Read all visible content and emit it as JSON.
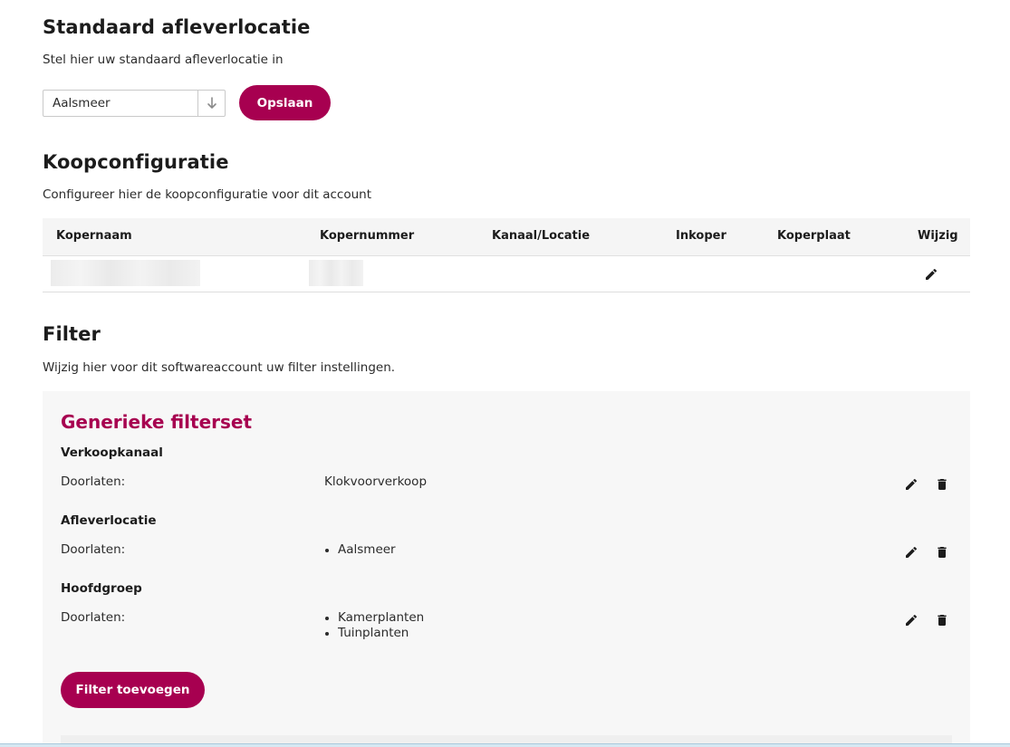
{
  "delivery": {
    "title": "Standaard afleverlocatie",
    "subtitle": "Stel hier uw standaard afleverlocatie in",
    "selected_location": "Aalsmeer",
    "save_label": "Opslaan"
  },
  "buy_config": {
    "title": "Koopconfiguratie",
    "subtitle": "Configureer hier de koopconfiguratie voor dit account",
    "columns": [
      "Kopernaam",
      "Kopernummer",
      "Kanaal/Locatie",
      "Inkoper",
      "Koperplaat",
      "Wijzig"
    ]
  },
  "filter": {
    "title": "Filter",
    "subtitle": "Wijzig hier voor dit softwareaccount uw filter instellingen.",
    "set_title": "Generieke filterset",
    "groups": [
      {
        "title": "Verkoopkanaal",
        "label": "Doorlaten:",
        "value": "Klokvoorverkoop"
      },
      {
        "title": "Afleverlocatie",
        "label": "Doorlaten:",
        "items": [
          "Aalsmeer"
        ]
      },
      {
        "title": "Hoofdgroep",
        "label": "Doorlaten:",
        "items": [
          "Kamerplanten",
          "Tuinplanten"
        ]
      }
    ],
    "add_label": "Filter toevoegen"
  },
  "colors": {
    "accent": "#a70050",
    "panel_bg": "#f7f7f7"
  },
  "icons": [
    "chevron-down-icon",
    "pencil-icon",
    "trash-icon"
  ]
}
